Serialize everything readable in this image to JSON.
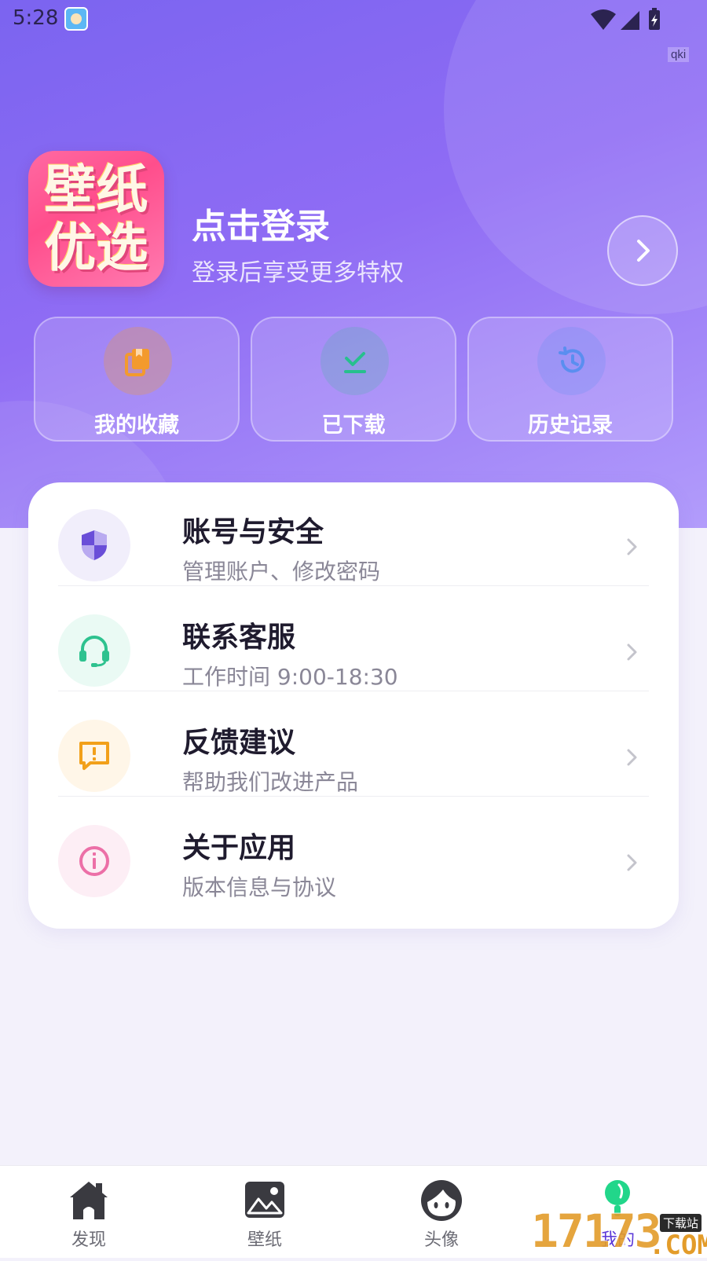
{
  "status_bar": {
    "time": "5:28",
    "app_icon": "app-avatar-icon",
    "icons": [
      "wifi-icon",
      "signal-icon",
      "battery-icon"
    ],
    "badge": "qki"
  },
  "profile": {
    "logo_line1": "壁纸",
    "logo_line2": "优选",
    "login_title": "点击登录",
    "login_subtitle": "登录后享受更多特权"
  },
  "quick_actions": [
    {
      "label": "我的收藏",
      "icon": "bookmark-icon",
      "color": "#f39a2d"
    },
    {
      "label": "已下载",
      "icon": "download-icon",
      "color": "#27c08d"
    },
    {
      "label": "历史记录",
      "icon": "history-icon",
      "color": "#5a8ef0"
    }
  ],
  "menu": [
    {
      "title": "账号与安全",
      "subtitle": "管理账户、修改密码",
      "icon": "shield-icon",
      "color": "#6a4ed8",
      "bg": "#f1eefb"
    },
    {
      "title": "联系客服",
      "subtitle": "工作时间 9:00-18:30",
      "icon": "headset-icon",
      "color": "#2ec28f",
      "bg": "#eafaf4"
    },
    {
      "title": "反馈建议",
      "subtitle": "帮助我们改进产品",
      "icon": "feedback-icon",
      "color": "#f2a01a",
      "bg": "#fff6e8"
    },
    {
      "title": "关于应用",
      "subtitle": "版本信息与协议",
      "icon": "info-icon",
      "color": "#ec6fa7",
      "bg": "#fdeef5"
    }
  ],
  "bottom_nav": [
    {
      "label": "发现",
      "icon": "home-icon"
    },
    {
      "label": "壁纸",
      "icon": "image-icon"
    },
    {
      "label": "头像",
      "icon": "avatar-icon"
    },
    {
      "label": "我的",
      "icon": "profile-icon",
      "active": true
    }
  ],
  "watermark": {
    "number": "17173",
    "tag": "下载站",
    "suffix": ".COM"
  },
  "colors": {
    "accent": "#7b64f0",
    "active_nav": "#5a37d8"
  }
}
